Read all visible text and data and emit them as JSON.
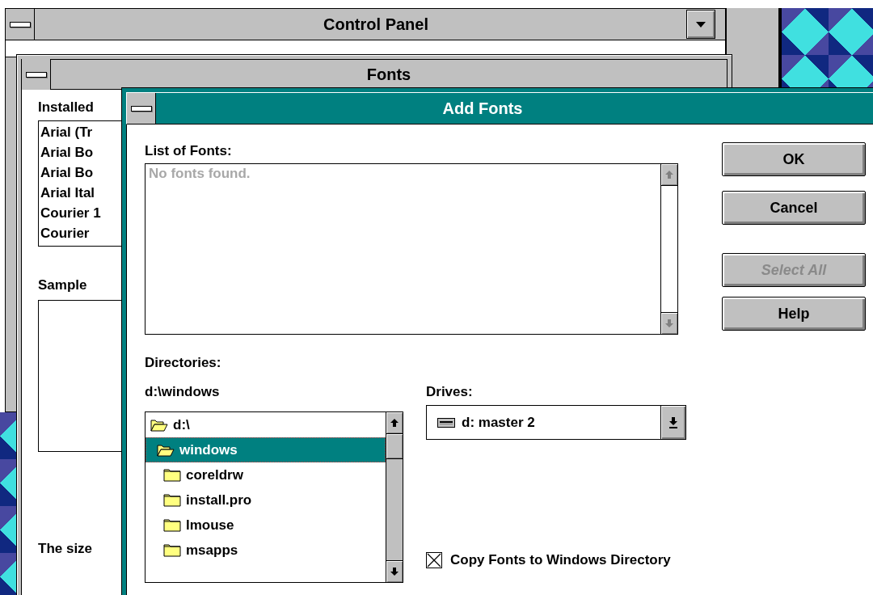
{
  "control_panel": {
    "title": "Control Panel"
  },
  "fonts_window": {
    "title": "Fonts",
    "installed_label": "Installed",
    "installed_fonts": [
      "Arial (Tr",
      "Arial Bo",
      "Arial Bo",
      "Arial Ital",
      "Courier 1",
      "Courier"
    ],
    "sample_label": "Sample",
    "footer_text": "The size"
  },
  "dialog": {
    "title": "Add Fonts",
    "list_label": "List of Fonts:",
    "list_message": "No fonts found.",
    "buttons": [
      {
        "label": "OK",
        "disabled": false
      },
      {
        "label": "Cancel",
        "disabled": false
      },
      {
        "label": "Select All",
        "disabled": true
      },
      {
        "label": "Help",
        "disabled": false
      }
    ],
    "directories_label": "Directories:",
    "current_path": "d:\\windows",
    "directories": [
      {
        "name": "d:\\",
        "selected": false,
        "children": [
          {
            "name": "windows",
            "selected": true,
            "children": [
              {
                "name": "coreldrw",
                "selected": false
              },
              {
                "name": "install.pro",
                "selected": false
              },
              {
                "name": "lmouse",
                "selected": false
              },
              {
                "name": "msapps",
                "selected": false
              }
            ]
          }
        ]
      }
    ],
    "drives_label": "Drives:",
    "drive": "d: master 2",
    "copy_option": {
      "label": "Copy Fonts to Windows Directory",
      "checked": true
    }
  }
}
